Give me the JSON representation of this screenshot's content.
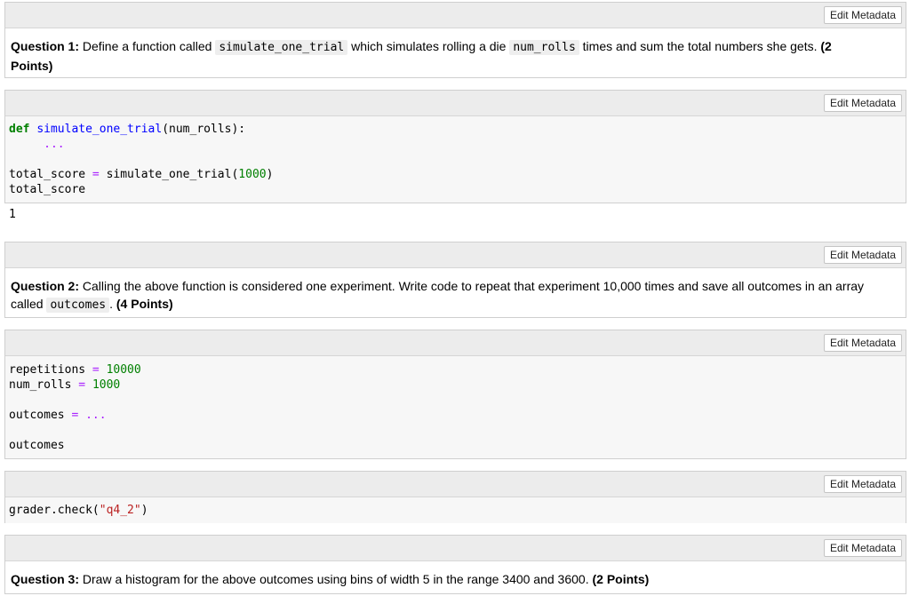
{
  "toolbar": {
    "edit_metadata_label": "Edit Metadata"
  },
  "q1": {
    "label": "Question 1:",
    "text_before": "Define a function called",
    "code_func": "simulate_one_trial",
    "text_mid": "which simulates rolling a die",
    "code_param": "num_rolls",
    "text_after": "times and sum the total numbers she gets.",
    "points_line1": "(2",
    "points_line2": "Points)"
  },
  "code1": {
    "def_kw": "def",
    "func_name": "simulate_one_trial",
    "params": "(num_rolls):",
    "body": "...",
    "assign_var": "total_score",
    "eq": "=",
    "call": "simulate_one_trial(",
    "arg": "1000",
    "close": ")",
    "last_line": "total_score"
  },
  "output1": "1",
  "q2": {
    "label": "Question 2:",
    "text_line1": "Calling the above function is considered one experiment. Write code to repeat that experiment 10,000 times and save all outcomes in an array",
    "text_called": "called",
    "code_var": "outcomes",
    "text_period": ".",
    "points": "(4 Points)"
  },
  "code2": {
    "var1": "repetitions",
    "val1": "10000",
    "var2": "num_rolls",
    "val2": "1000",
    "var3": "outcomes",
    "val3": "...",
    "eq": "=",
    "last_line": "outcomes"
  },
  "code3": {
    "prefix": "grader.check(",
    "arg": "\"q4_2\"",
    "suffix": ")"
  },
  "q3": {
    "label": "Question 3:",
    "text": "Draw a histogram for the above outcomes using bins of width 5 in the range 3400 and 3600.",
    "points": "(2 Points)"
  }
}
